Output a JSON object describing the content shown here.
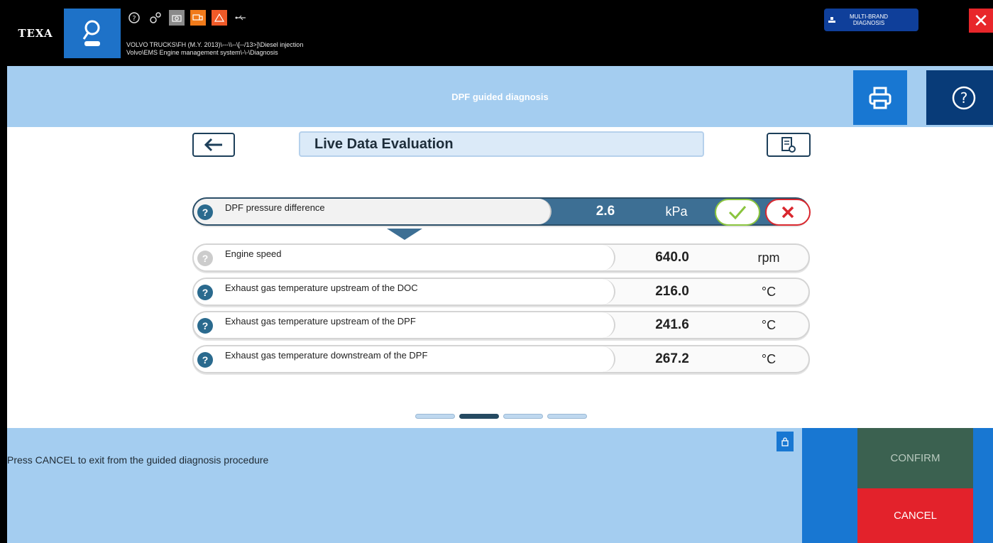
{
  "topbar": {
    "brand": "TEXA",
    "path_line1": "VOLVO TRUCKS\\FH (M.Y. 2013)\\---\\\\--\\[--/13>]\\Diesel injection",
    "path_line2": "Volvo\\EMS Engine management system\\-\\-\\Diagnosis",
    "multibrand_line1": "MULTI-BRAND",
    "multibrand_line2": "DIAGNOSIS",
    "icons": [
      "help-icon",
      "gears-icon",
      "camera-icon",
      "truck-icon",
      "warning-icon",
      "usb-icon"
    ]
  },
  "header": {
    "title": "DPF guided diagnosis"
  },
  "section": {
    "title": "Live Data Evaluation"
  },
  "parameters": [
    {
      "label": "DPF pressure difference",
      "value": "2.6",
      "unit": "kPa",
      "active": true
    },
    {
      "label": "Engine speed",
      "value": "640.0",
      "unit": "rpm",
      "active": false
    },
    {
      "label": "Exhaust gas temperature upstream of the DOC",
      "value": "216.0",
      "unit": "°C",
      "active": false
    },
    {
      "label": "Exhaust gas temperature upstream of the DPF",
      "value": "241.6",
      "unit": "°C",
      "active": false
    },
    {
      "label": "Exhaust gas temperature downstream of the DPF",
      "value": "267.2",
      "unit": "°C",
      "active": false
    }
  ],
  "pager": {
    "pages": 4,
    "current": 2
  },
  "footer": {
    "hint": "Press CANCEL to exit from the guided diagnosis procedure",
    "confirm_label": "CONFIRM",
    "cancel_label": "CANCEL"
  },
  "colors": {
    "accent": "#1877d2",
    "header_band": "#a4cdf0",
    "active_row": "#3d6f94",
    "confirm": "#3b6150",
    "cancel": "#e3222b"
  }
}
